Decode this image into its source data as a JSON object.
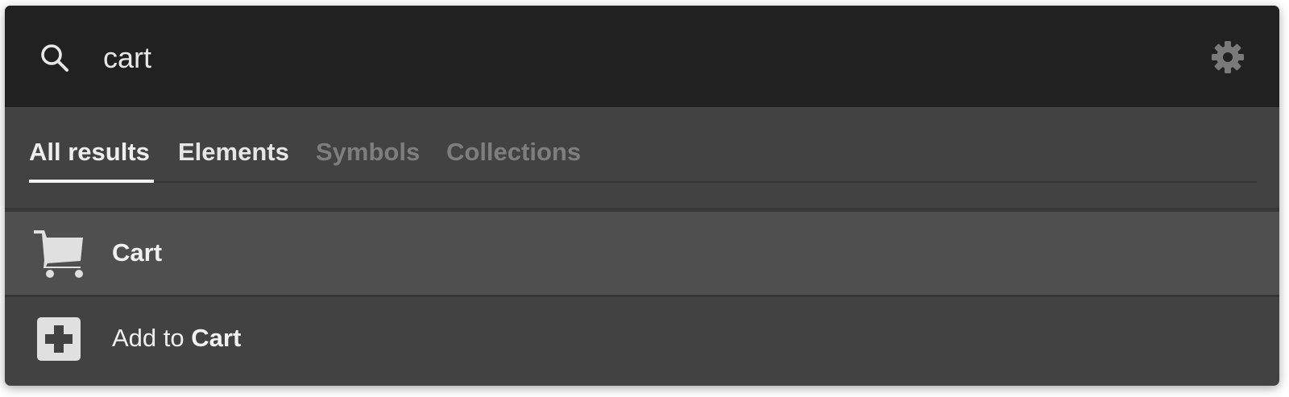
{
  "search": {
    "query": "cart",
    "icon": "search-icon",
    "settings_icon": "gear-icon"
  },
  "tabs": [
    {
      "label": "All results",
      "state": "active"
    },
    {
      "label": "Elements",
      "state": "normal"
    },
    {
      "label": "Symbols",
      "state": "disabled"
    },
    {
      "label": "Collections",
      "state": "disabled"
    }
  ],
  "results": [
    {
      "icon": "shopping-cart-icon",
      "label_plain": "",
      "label_match": "Cart",
      "highlighted": true
    },
    {
      "icon": "plus-square-icon",
      "label_plain": "Add to ",
      "label_match": "Cart",
      "highlighted": false
    }
  ],
  "colors": {
    "search_bg": "#212121",
    "panel_bg": "#424242",
    "highlight_row": "#4f4f4f",
    "text": "#eeeeee",
    "dim_text": "#7e7e7e"
  }
}
